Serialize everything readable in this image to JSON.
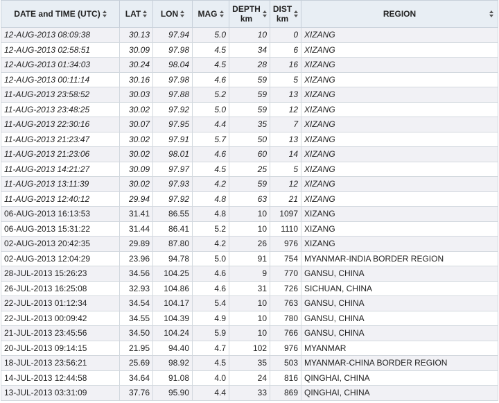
{
  "table": {
    "headers": [
      {
        "line1": "DATE and TIME (UTC)",
        "line2": ""
      },
      {
        "line1": "LAT",
        "line2": ""
      },
      {
        "line1": "LON",
        "line2": ""
      },
      {
        "line1": "MAG",
        "line2": ""
      },
      {
        "line1": "DEPTH",
        "line2": "km"
      },
      {
        "line1": "DIST",
        "line2": "km"
      },
      {
        "line1": "REGION",
        "line2": ""
      }
    ],
    "sort_icon": "sort-up-down-icon",
    "header_bg": "#e8eef4",
    "odd_row_bg": "#f1f1f5",
    "rows": [
      {
        "datetime": "12-AUG-2013 08:09:38",
        "lat": "30.13",
        "lon": "97.94",
        "mag": "5.0",
        "depth": "10",
        "dist": "0",
        "region": "XIZANG",
        "italic": true
      },
      {
        "datetime": "12-AUG-2013 02:58:51",
        "lat": "30.09",
        "lon": "97.98",
        "mag": "4.5",
        "depth": "34",
        "dist": "6",
        "region": "XIZANG",
        "italic": true
      },
      {
        "datetime": "12-AUG-2013 01:34:03",
        "lat": "30.24",
        "lon": "98.04",
        "mag": "4.5",
        "depth": "28",
        "dist": "16",
        "region": "XIZANG",
        "italic": true
      },
      {
        "datetime": "12-AUG-2013 00:11:14",
        "lat": "30.16",
        "lon": "97.98",
        "mag": "4.6",
        "depth": "59",
        "dist": "5",
        "region": "XIZANG",
        "italic": true
      },
      {
        "datetime": "11-AUG-2013 23:58:52",
        "lat": "30.03",
        "lon": "97.88",
        "mag": "5.2",
        "depth": "59",
        "dist": "13",
        "region": "XIZANG",
        "italic": true
      },
      {
        "datetime": "11-AUG-2013 23:48:25",
        "lat": "30.02",
        "lon": "97.92",
        "mag": "5.0",
        "depth": "59",
        "dist": "12",
        "region": "XIZANG",
        "italic": true
      },
      {
        "datetime": "11-AUG-2013 22:30:16",
        "lat": "30.07",
        "lon": "97.95",
        "mag": "4.4",
        "depth": "35",
        "dist": "7",
        "region": "XIZANG",
        "italic": true
      },
      {
        "datetime": "11-AUG-2013 21:23:47",
        "lat": "30.02",
        "lon": "97.91",
        "mag": "5.7",
        "depth": "50",
        "dist": "13",
        "region": "XIZANG",
        "italic": true
      },
      {
        "datetime": "11-AUG-2013 21:23:06",
        "lat": "30.02",
        "lon": "98.01",
        "mag": "4.6",
        "depth": "60",
        "dist": "14",
        "region": "XIZANG",
        "italic": true
      },
      {
        "datetime": "11-AUG-2013 14:21:27",
        "lat": "30.09",
        "lon": "97.97",
        "mag": "4.5",
        "depth": "25",
        "dist": "5",
        "region": "XIZANG",
        "italic": true
      },
      {
        "datetime": "11-AUG-2013 13:11:39",
        "lat": "30.02",
        "lon": "97.93",
        "mag": "4.2",
        "depth": "59",
        "dist": "12",
        "region": "XIZANG",
        "italic": true
      },
      {
        "datetime": "11-AUG-2013 12:40:12",
        "lat": "29.94",
        "lon": "97.92",
        "mag": "4.8",
        "depth": "63",
        "dist": "21",
        "region": "XIZANG",
        "italic": true
      },
      {
        "datetime": "06-AUG-2013 16:13:53",
        "lat": "31.41",
        "lon": "86.55",
        "mag": "4.8",
        "depth": "10",
        "dist": "1097",
        "region": "XIZANG",
        "italic": false
      },
      {
        "datetime": "06-AUG-2013 15:31:22",
        "lat": "31.44",
        "lon": "86.41",
        "mag": "5.2",
        "depth": "10",
        "dist": "1110",
        "region": "XIZANG",
        "italic": false
      },
      {
        "datetime": "02-AUG-2013 20:42:35",
        "lat": "29.89",
        "lon": "87.80",
        "mag": "4.2",
        "depth": "26",
        "dist": "976",
        "region": "XIZANG",
        "italic": false
      },
      {
        "datetime": "02-AUG-2013 12:04:29",
        "lat": "23.96",
        "lon": "94.78",
        "mag": "5.0",
        "depth": "91",
        "dist": "754",
        "region": "MYANMAR-INDIA BORDER REGION",
        "italic": false
      },
      {
        "datetime": "28-JUL-2013 15:26:23",
        "lat": "34.56",
        "lon": "104.25",
        "mag": "4.6",
        "depth": "9",
        "dist": "770",
        "region": "GANSU, CHINA",
        "italic": false
      },
      {
        "datetime": "26-JUL-2013 16:25:08",
        "lat": "32.93",
        "lon": "104.86",
        "mag": "4.6",
        "depth": "31",
        "dist": "726",
        "region": "SICHUAN, CHINA",
        "italic": false
      },
      {
        "datetime": "22-JUL-2013 01:12:34",
        "lat": "34.54",
        "lon": "104.17",
        "mag": "5.4",
        "depth": "10",
        "dist": "763",
        "region": "GANSU, CHINA",
        "italic": false
      },
      {
        "datetime": "22-JUL-2013 00:09:42",
        "lat": "34.55",
        "lon": "104.39",
        "mag": "4.9",
        "depth": "10",
        "dist": "780",
        "region": "GANSU, CHINA",
        "italic": false
      },
      {
        "datetime": "21-JUL-2013 23:45:56",
        "lat": "34.50",
        "lon": "104.24",
        "mag": "5.9",
        "depth": "10",
        "dist": "766",
        "region": "GANSU, CHINA",
        "italic": false
      },
      {
        "datetime": "20-JUL-2013 09:14:15",
        "lat": "21.95",
        "lon": "94.40",
        "mag": "4.7",
        "depth": "102",
        "dist": "976",
        "region": "MYANMAR",
        "italic": false
      },
      {
        "datetime": "18-JUL-2013 23:56:21",
        "lat": "25.69",
        "lon": "98.92",
        "mag": "4.5",
        "depth": "35",
        "dist": "503",
        "region": "MYANMAR-CHINA BORDER REGION",
        "italic": false
      },
      {
        "datetime": "14-JUL-2013 12:44:58",
        "lat": "34.64",
        "lon": "91.08",
        "mag": "4.0",
        "depth": "24",
        "dist": "816",
        "region": "QINGHAI, CHINA",
        "italic": false
      },
      {
        "datetime": "13-JUL-2013 03:31:09",
        "lat": "37.76",
        "lon": "95.90",
        "mag": "4.4",
        "depth": "33",
        "dist": "869",
        "region": "QINGHAI, CHINA",
        "italic": false
      }
    ]
  }
}
